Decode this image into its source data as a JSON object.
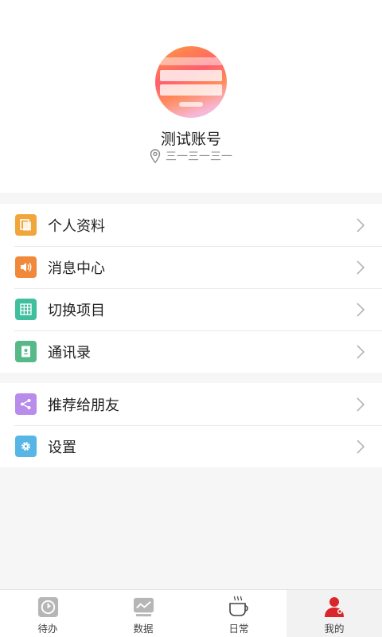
{
  "profile": {
    "name": "测试账号",
    "location": "三一三一三一"
  },
  "menu": {
    "group1": [
      {
        "label": "个人资料",
        "icon": "profile-card-icon",
        "color": "#f0a63a"
      },
      {
        "label": "消息中心",
        "icon": "speaker-icon",
        "color": "#f08a3a"
      },
      {
        "label": "切换项目",
        "icon": "building-icon",
        "color": "#3fbf9d"
      },
      {
        "label": "通讯录",
        "icon": "contacts-book-icon",
        "color": "#57b98a"
      }
    ],
    "group2": [
      {
        "label": "推荐给朋友",
        "icon": "share-icon",
        "color": "#b98bea"
      },
      {
        "label": "设置",
        "icon": "gear-icon",
        "color": "#57b6e6"
      }
    ]
  },
  "tabbar": {
    "tabs": [
      {
        "label": "待办",
        "icon": "clock-check-icon"
      },
      {
        "label": "数据",
        "icon": "chart-icon"
      },
      {
        "label": "日常",
        "icon": "coffee-cup-icon"
      },
      {
        "label": "我的",
        "icon": "user-icon",
        "active": true,
        "color": "#d9262c"
      }
    ]
  }
}
